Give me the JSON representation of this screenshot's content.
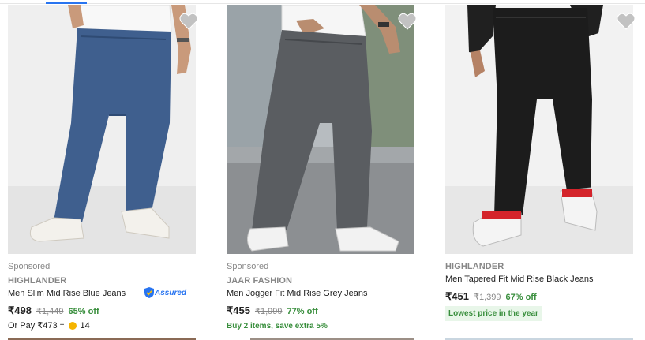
{
  "products": [
    {
      "sponsored": "Sponsored",
      "brand": "HIGHLANDER",
      "title": "Men Slim Mid Rise Blue Jeans",
      "price": "₹498",
      "mrp": "₹1,449",
      "discount": "65% off",
      "assured": "Assured",
      "or_pay": "Or Pay ₹473",
      "or_pay_plus": "+",
      "coins": "14",
      "image": "man-in-blue-jeans"
    },
    {
      "sponsored": "Sponsored",
      "brand": "JAAR FASHION",
      "title": "Men Jogger Fit Mid Rise Grey Jeans",
      "price": "₹455",
      "mrp": "₹1,999",
      "discount": "77% off",
      "offer": "Buy 2 items, save extra 5%",
      "image": "man-in-grey-jeans"
    },
    {
      "brand": "HIGHLANDER",
      "title": "Men Tapered Fit Mid Rise Black Jeans",
      "price": "₹451",
      "mrp": "₹1,399",
      "discount": "67% off",
      "badge": "Lowest price in the year",
      "image": "man-in-black-jeans"
    }
  ],
  "colors": {
    "discount_green": "#388e3c",
    "assured_blue": "#2874f0",
    "muted_grey": "#878787",
    "badge_bg": "#e8f6e9"
  }
}
